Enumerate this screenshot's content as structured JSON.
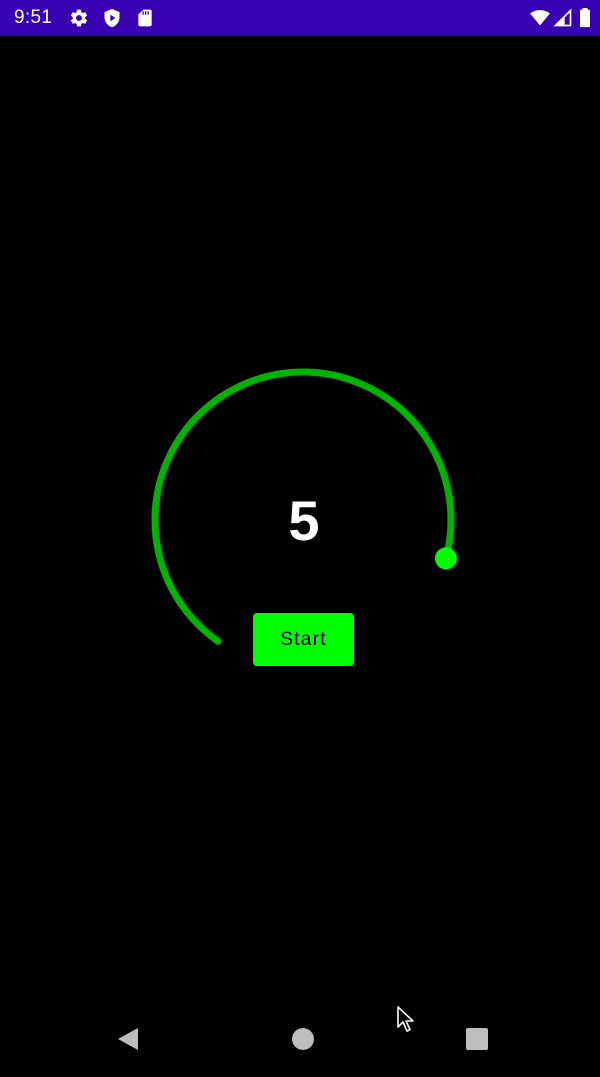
{
  "status_bar": {
    "time": "9:51",
    "background": "#3700b3",
    "left_icons": [
      "gear-icon",
      "shield-play-icon",
      "sd-card-icon"
    ],
    "right_icons": [
      "wifi-icon",
      "cellular-signal-icon",
      "battery-icon"
    ]
  },
  "timer": {
    "value": "5",
    "arc_color": "#00b300",
    "thumb_color": "#00ff00",
    "progress": 1.0
  },
  "start_button": {
    "label": "Start",
    "color": "#00ff00"
  },
  "nav_bar": {
    "buttons": [
      "back-icon",
      "home-icon",
      "recents-icon"
    ]
  }
}
